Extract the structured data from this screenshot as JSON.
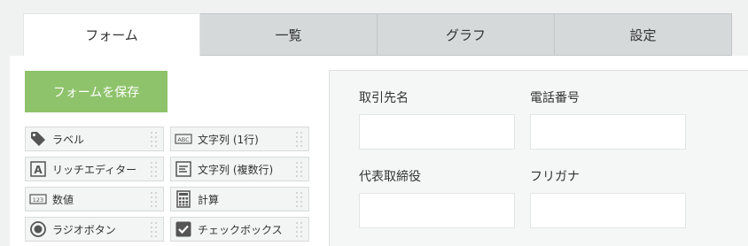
{
  "tabs": [
    {
      "label": "フォーム",
      "active": true
    },
    {
      "label": "一覧"
    },
    {
      "label": "グラフ"
    },
    {
      "label": "設定"
    }
  ],
  "save_button": {
    "label": "フォームを保存"
  },
  "palette": [
    {
      "label": "ラベル",
      "icon": "tag-icon"
    },
    {
      "label": "文字列 (1行)",
      "icon": "abc-text-icon"
    },
    {
      "label": "リッチエディター",
      "icon": "rich-editor-icon"
    },
    {
      "label": "文字列 (複数行)",
      "icon": "multiline-text-icon"
    },
    {
      "label": "数値",
      "icon": "number-123-icon"
    },
    {
      "label": "計算",
      "icon": "calculator-icon"
    },
    {
      "label": "ラジオボタン",
      "icon": "radio-button-icon"
    },
    {
      "label": "チェックボックス",
      "icon": "checkbox-icon"
    }
  ],
  "form_fields": [
    {
      "label": "取引先名",
      "value": ""
    },
    {
      "label": "電話番号",
      "value": ""
    },
    {
      "label": "代表取締役",
      "value": ""
    },
    {
      "label": "フリガナ",
      "value": ""
    }
  ],
  "colors": {
    "accent": "#8ec36b",
    "tab_bg": "#d5d9d9",
    "canvas_bg": "#f5f6f6"
  }
}
